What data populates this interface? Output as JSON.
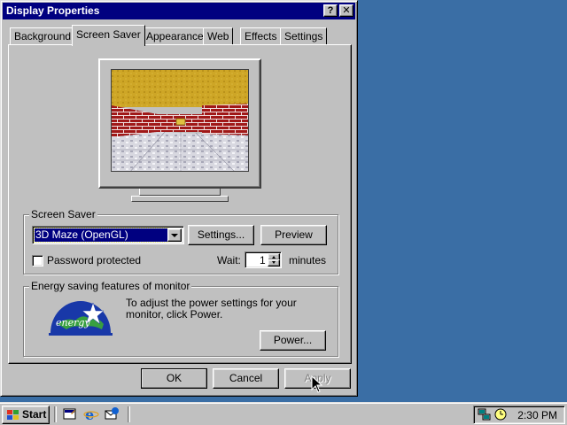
{
  "window": {
    "title": "Display Properties",
    "help_button": "?",
    "close_button": "✕"
  },
  "tabs": [
    {
      "label": "Background",
      "active": false
    },
    {
      "label": "Screen Saver",
      "active": true
    },
    {
      "label": "Appearance",
      "active": false
    },
    {
      "label": "Web",
      "active": false
    },
    {
      "label": "Effects",
      "active": false
    },
    {
      "label": "Settings",
      "active": false
    }
  ],
  "screen_saver": {
    "group_label": "Screen Saver",
    "selected": "3D Maze (OpenGL)",
    "settings_button": "Settings...",
    "preview_button": "Preview",
    "password_label": "Password protected",
    "password_checked": false,
    "wait_label": "Wait:",
    "wait_value": "1",
    "wait_unit": "minutes"
  },
  "energy": {
    "group_label": "Energy saving features of monitor",
    "description": "To adjust the power settings for your monitor, click Power.",
    "power_button": "Power...",
    "logo_text": "energy"
  },
  "dialog_buttons": {
    "ok": "OK",
    "cancel": "Cancel",
    "apply": "Apply"
  },
  "taskbar": {
    "start_label": "Start",
    "clock": "2:30 PM"
  },
  "colors": {
    "desktop": "#3a6ea5",
    "titlebar": "#000080",
    "face": "#c0c0c0",
    "maze_ceiling": "#c8a020",
    "maze_brick": "#a01818"
  }
}
